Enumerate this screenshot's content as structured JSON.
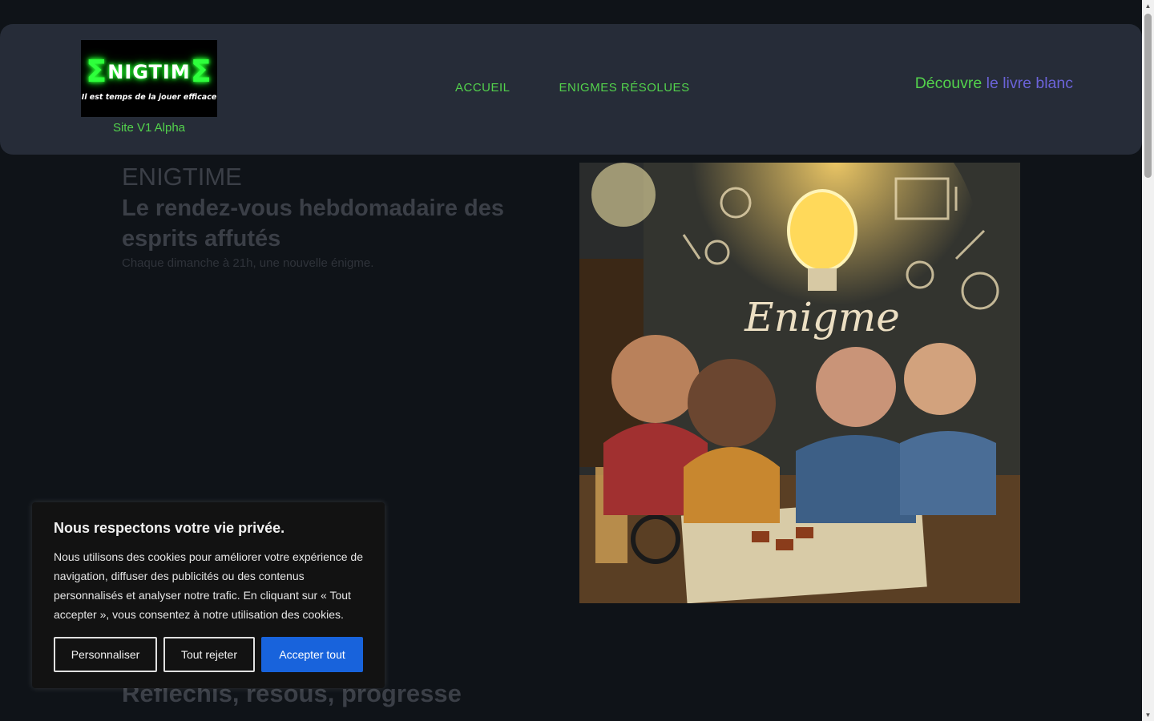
{
  "header": {
    "logo": {
      "main": "NIGTIM",
      "symbol": "Σ",
      "tagline": "Il est temps de la jouer efficace"
    },
    "version": "Site V1 Alpha",
    "nav": [
      {
        "label": "ACCUEIL"
      },
      {
        "label": "ENIGMES RÉSOLUES"
      }
    ],
    "cta": {
      "part1": "Découvre",
      "part2": " le livre blanc"
    }
  },
  "hero": {
    "title": "ENIGTIME",
    "subtitle": "Le rendez-vous hebdomadaire des esprits affutés",
    "description": "Chaque dimanche à 21h, une nouvelle énigme.",
    "image_text": "Enigme"
  },
  "section": {
    "title": "Réfléchis, résous, progresse"
  },
  "cookie": {
    "title": "Nous respectons votre vie privée.",
    "body": "Nous utilisons des cookies pour améliorer votre expérience de navigation, diffuser des publicités ou des contenus personnalisés et analyser notre trafic. En cliquant sur « Tout accepter », vous consentez à notre utilisation des cookies.",
    "buttons": {
      "customize": "Personnaliser",
      "reject": "Tout rejeter",
      "accept": "Accepter tout"
    }
  },
  "colors": {
    "accent_green": "#53d24c",
    "accent_purple": "#6b63d9",
    "accept_blue": "#1863dc",
    "header_bg": "#262c38",
    "page_bg": "#0f1318"
  },
  "scrollbar": {
    "up_icon": "triangle-up",
    "down_icon": "triangle-down"
  }
}
